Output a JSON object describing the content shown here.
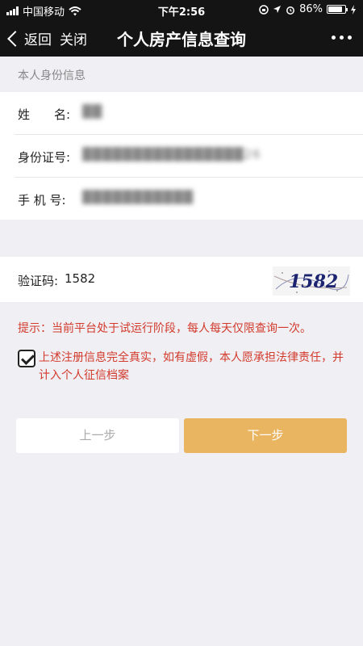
{
  "status_bar": {
    "carrier": "中国移动",
    "time": "下午2:56",
    "battery_percent": "86%",
    "battery_level": 0.86,
    "icons": [
      "signal-icon",
      "wifi-icon",
      "rotation-lock-icon",
      "location-icon",
      "alarm-icon",
      "battery-icon",
      "charging-icon"
    ]
  },
  "nav": {
    "back_label": "返回",
    "close_label": "关闭",
    "title": "个人房产信息查询",
    "more_icon": "more-dots-icon"
  },
  "identity": {
    "section_title": "本人身份信息",
    "name": {
      "label": "姓　　名:",
      "value": "██"
    },
    "id_number": {
      "label": "身份证号:",
      "value": "████████████████26"
    },
    "phone": {
      "label": "手 机 号:",
      "value": "███████████"
    }
  },
  "captcha": {
    "label": "验证码:",
    "input_value": "1582",
    "image_text": "1582"
  },
  "notice": "提示：当前平台处于试运行阶段，每人每天仅限查询一次。",
  "agreement": {
    "checked": true,
    "text": "上述注册信息完全真实，如有虚假，本人愿承担法律责任，并计入个人征信档案"
  },
  "buttons": {
    "prev_label": "上一步",
    "next_label": "下一步"
  },
  "colors": {
    "nav_bg": "#141414",
    "page_bg": "#efeff4",
    "warning": "#d33a2c",
    "primary_button": "#e9b560",
    "captcha_text": "#1c2370"
  }
}
